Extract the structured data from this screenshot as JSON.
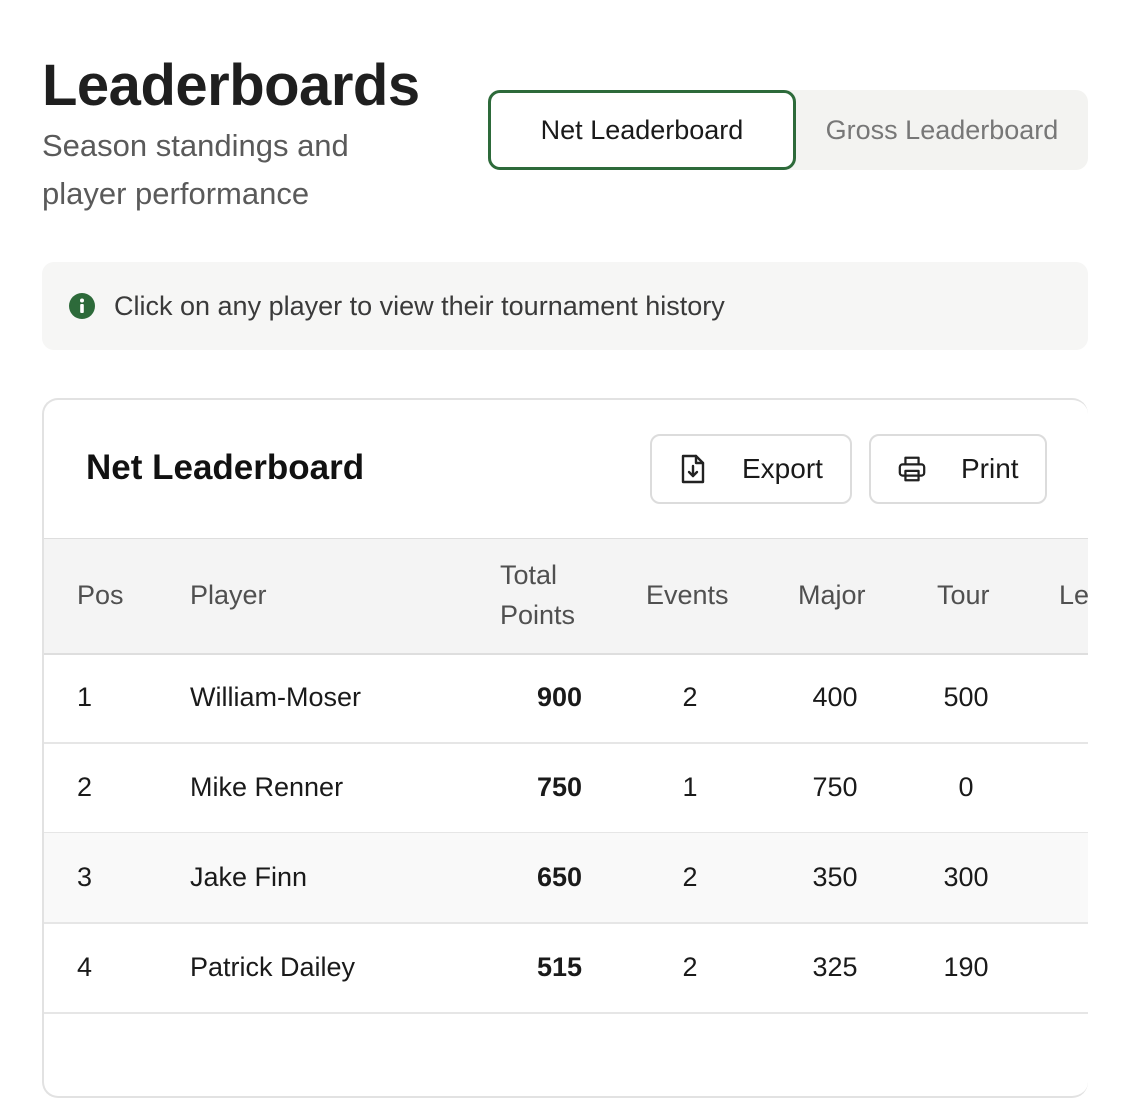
{
  "header": {
    "title": "Leaderboards",
    "subtitle": "Season standings and player performance"
  },
  "toggle": {
    "options": [
      "Net Leaderboard",
      "Gross Leaderboard"
    ],
    "selected": "Net Leaderboard"
  },
  "info": {
    "icon": "info-icon",
    "text": "Click on any player to view their tournament history"
  },
  "card": {
    "title": "Net Leaderboard",
    "export_label": "Export",
    "print_label": "Print",
    "columns": [
      "Pos",
      "Player",
      "Total Points",
      "Events",
      "Major",
      "Tour",
      "Le"
    ],
    "rows": [
      {
        "pos": "1",
        "player": "William-Moser",
        "total": "900",
        "events": "2",
        "major": "400",
        "tour": "500"
      },
      {
        "pos": "2",
        "player": "Mike Renner",
        "total": "750",
        "events": "1",
        "major": "750",
        "tour": "0"
      },
      {
        "pos": "3",
        "player": "Jake Finn",
        "total": "650",
        "events": "2",
        "major": "350",
        "tour": "300"
      },
      {
        "pos": "4",
        "player": "Patrick Dailey",
        "total": "515",
        "events": "2",
        "major": "325",
        "tour": "190"
      }
    ]
  },
  "colors": {
    "accent": "#2d6a3a"
  }
}
